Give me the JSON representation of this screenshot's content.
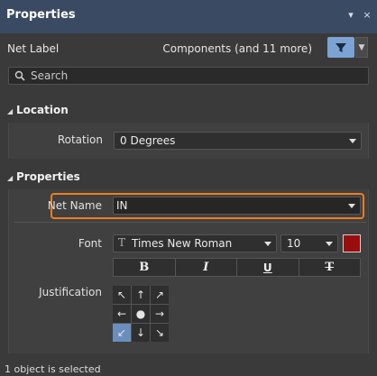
{
  "panel": {
    "title": "Properties",
    "menu_glyph": "▾",
    "close_glyph": "×"
  },
  "header": {
    "object_type": "Net Label",
    "filter_text": "Components (and 11 more)",
    "filter_icon": "filter-icon"
  },
  "search": {
    "placeholder": "Search"
  },
  "location": {
    "section_title": "Location",
    "rotation_label": "Rotation",
    "rotation_value": "0 Degrees"
  },
  "properties": {
    "section_title": "Properties",
    "net_name_label": "Net Name",
    "net_name_value": "IN",
    "font_label": "Font",
    "font_family": "Times New Roman",
    "font_size": "10",
    "font_color": "#9a0d0d",
    "style_buttons": [
      {
        "label": "B",
        "name": "bold"
      },
      {
        "label": "I",
        "name": "italic"
      },
      {
        "label": "U",
        "name": "underline"
      },
      {
        "label": "T",
        "name": "strikethrough"
      }
    ],
    "justification_label": "Justification",
    "justification_cells": [
      "↖",
      "↑",
      "↗",
      "←",
      "●",
      "→",
      "↙",
      "↓",
      "↘"
    ],
    "justification_selected": "bottom-left"
  },
  "status_bar": {
    "text": "1 object is selected"
  },
  "colors": {
    "titlebar": "#3b4a63",
    "accent": "#7ba3d4",
    "highlight": "#f07d1a",
    "background": "#3a3a3a"
  }
}
